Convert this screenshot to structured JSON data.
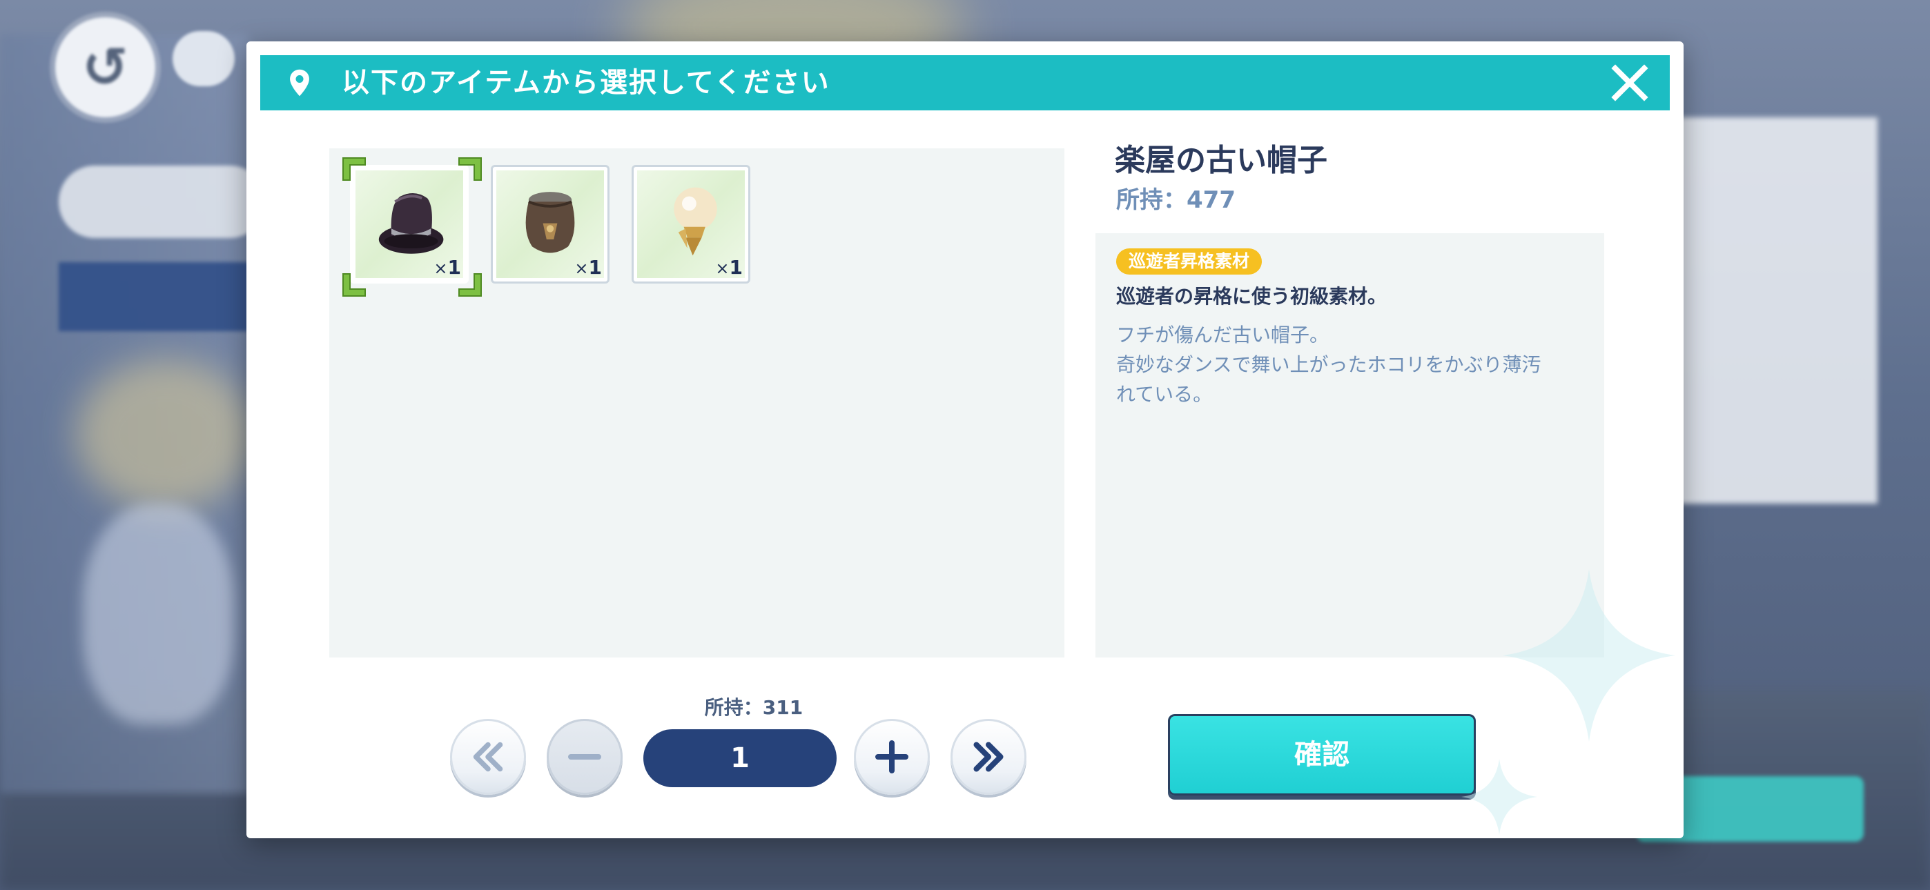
{
  "dialog": {
    "title": "以下のアイテムから選択してください"
  },
  "items": [
    {
      "icon": "top-hat-icon",
      "qty_prefix": "×",
      "qty": "1",
      "selected": true
    },
    {
      "icon": "bag-icon",
      "qty_prefix": "×",
      "qty": "1",
      "selected": false
    },
    {
      "icon": "bulb-icon",
      "qty_prefix": "×",
      "qty": "1",
      "selected": false
    }
  ],
  "detail": {
    "name": "楽屋の古い帽子",
    "owned": "所持：477",
    "tag": "巡遊者昇格素材",
    "summary": "巡遊者の昇格に使う初級素材。",
    "flavor_line1": "フチが傷んだ古い帽子。",
    "flavor_line2": "奇妙なダンスで舞い上がったホコリをかぶり薄汚",
    "flavor_line3": "れている。"
  },
  "quantity": {
    "owned": "所持：311",
    "value": "1"
  },
  "actions": {
    "confirm": "確認"
  },
  "colors": {
    "header": "#1cbdc3",
    "quantity_field": "#26427a",
    "tag": "#f6c021",
    "confirm": "#22d3d6"
  }
}
